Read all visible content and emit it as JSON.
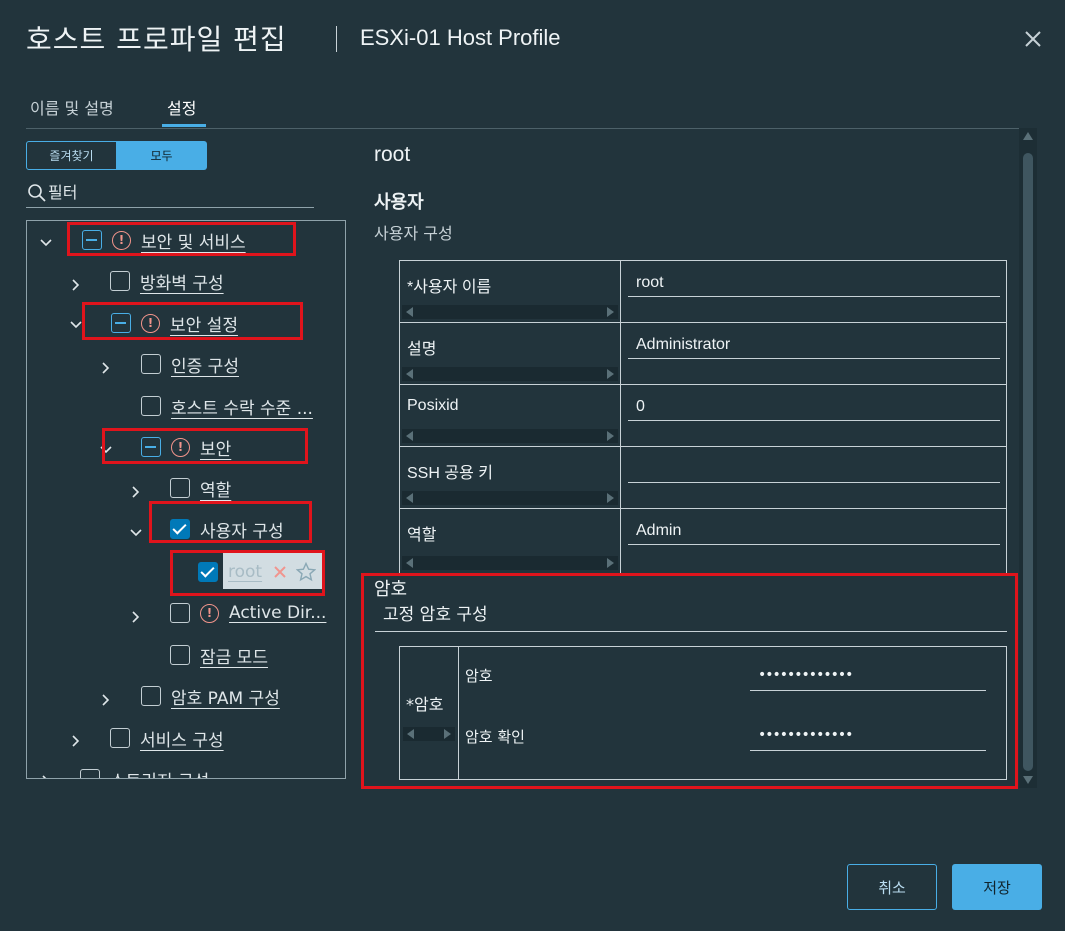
{
  "header": {
    "title": "호스트 프로파일 편집",
    "subtitle": "ESXi-01 Host Profile",
    "close_icon": "close-icon"
  },
  "tabs": [
    {
      "label": "이름 및 설명",
      "active": false
    },
    {
      "label": "설정",
      "active": true
    }
  ],
  "toggle": {
    "favorites": "즐겨찾기",
    "all": "모두"
  },
  "filter": {
    "placeholder": "필터",
    "icon": "search-icon"
  },
  "tree": {
    "items": [
      {
        "label": "보안 및 서비스",
        "state": "partial",
        "warning": true,
        "expanded": true
      },
      {
        "label": "방화벽 구성",
        "state": "unchecked",
        "expanded": false
      },
      {
        "label": "보안 설정",
        "state": "partial",
        "warning": true,
        "expanded": true
      },
      {
        "label": "인증 구성",
        "state": "unchecked",
        "expanded": false
      },
      {
        "label": "호스트 수락 수준 ...",
        "state": "unchecked"
      },
      {
        "label": "보안",
        "state": "partial",
        "warning": true,
        "expanded": true
      },
      {
        "label": "역할",
        "state": "unchecked",
        "expanded": false
      },
      {
        "label": "사용자 구성",
        "state": "checked",
        "expanded": true
      },
      {
        "label": "root",
        "state": "checked",
        "selected": true
      },
      {
        "label": "Active Dir...",
        "state": "unchecked",
        "warning": true,
        "expanded": false
      },
      {
        "label": "잠금 모드",
        "state": "unchecked"
      },
      {
        "label": "암호 PAM 구성",
        "state": "unchecked",
        "expanded": false
      },
      {
        "label": "서비스 구성",
        "state": "unchecked",
        "expanded": false
      },
      {
        "label": "스토리지 구성",
        "state": "unchecked",
        "expanded": false
      }
    ]
  },
  "detail": {
    "title": "root",
    "section": "사용자",
    "subsection": "사용자 구성",
    "fields": [
      {
        "key": "*사용자 이름",
        "value": "root"
      },
      {
        "key": "설명",
        "value": "Administrator"
      },
      {
        "key": "Posixid",
        "value": "0"
      },
      {
        "key": "SSH 공용 키",
        "value": ""
      },
      {
        "key": "역할",
        "value": "Admin"
      }
    ],
    "password": {
      "section": "암호",
      "subsection": "고정 암호 구성",
      "key": "*암호",
      "password_label": "암호",
      "password_value": "•••••••••••••",
      "confirm_label": "암호 확인",
      "confirm_value": "•••••••••••••"
    }
  },
  "footer": {
    "cancel": "취소",
    "save": "저장"
  },
  "colors": {
    "accent": "#49aee6",
    "highlight": "#e0141c",
    "warning": "#f2948b",
    "background": "#22343c"
  }
}
